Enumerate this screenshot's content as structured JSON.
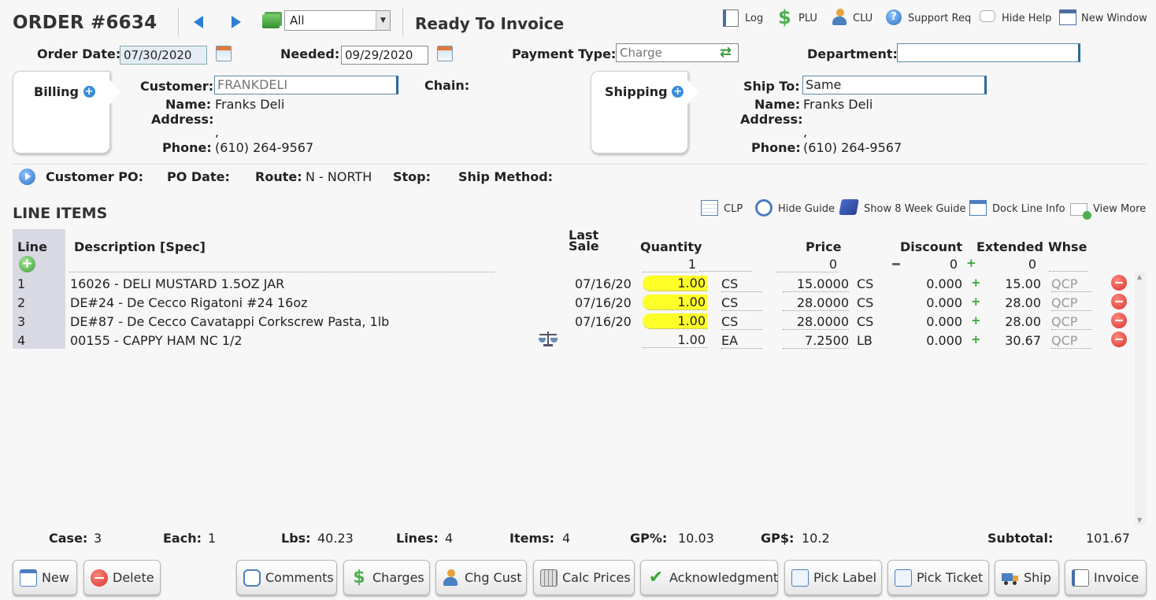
{
  "header": {
    "order_title": "ORDER #6634",
    "filter_value": "All",
    "status": "Ready To Invoice",
    "links": [
      "Log",
      "PLU",
      "CLU",
      "Support Req",
      "Hide Help",
      "New Window"
    ]
  },
  "order_info": {
    "order_date_label": "Order Date:",
    "order_date": "07/30/2020",
    "needed_label": "Needed:",
    "needed": "09/29/2020",
    "payment_type_label": "Payment Type:",
    "payment_type": "Charge",
    "department_label": "Department:",
    "department": ""
  },
  "billing": {
    "tab_label": "Billing",
    "customer_label": "Customer:",
    "customer": "FRANKDELI",
    "name_label": "Name:",
    "name": "Franks Deli",
    "address_label": "Address:",
    "address_line": ",",
    "phone_label": "Phone:",
    "phone": "(610) 264-9567",
    "chain_label": "Chain:"
  },
  "shipping": {
    "tab_label": "Shipping",
    "ship_to_label": "Ship To:",
    "ship_to": "Same",
    "name_label": "Name:",
    "name": "Franks Deli",
    "address_label": "Address:",
    "address_line": ",",
    "phone_label": "Phone:",
    "phone": "(610) 264-9567"
  },
  "po_bar": {
    "customer_po_label": "Customer PO:",
    "po_date_label": "PO Date:",
    "route_label": "Route:",
    "route": "N - NORTH",
    "stop_label": "Stop:",
    "ship_method_label": "Ship Method:"
  },
  "line_items": {
    "title": "LINE ITEMS",
    "links": [
      "CLP",
      "Hide Guide",
      "Show 8 Week Guide",
      "Dock Line Info",
      "View More"
    ],
    "headers": {
      "line": "Line",
      "description": "Description [Spec]",
      "last_sale_1": "Last",
      "last_sale_2": "Sale",
      "quantity": "Quantity",
      "price": "Price",
      "discount": "Discount",
      "extended": "Extended",
      "whse": "Whse"
    },
    "entry_row": {
      "quantity": "1",
      "price": "0",
      "discount": "0",
      "extended": "0"
    },
    "rows": [
      {
        "line": "1",
        "description": "16026 - DELI MUSTARD 1.5OZ JAR",
        "last_sale": "07/16/20",
        "quantity": "1.00",
        "qty_uom": "CS",
        "price": "15.0000",
        "price_uom": "CS",
        "discount": "0.000",
        "extended": "15.00",
        "whse": "QCP"
      },
      {
        "line": "2",
        "description": "DE#24 - De Cecco Rigatoni #24 16oz",
        "last_sale": "07/16/20",
        "quantity": "1.00",
        "qty_uom": "CS",
        "price": "28.0000",
        "price_uom": "CS",
        "discount": "0.000",
        "extended": "28.00",
        "whse": "QCP"
      },
      {
        "line": "3",
        "description": "DE#87 - De Cecco Cavatappi Corkscrew Pasta, 1lb",
        "last_sale": "07/16/20",
        "quantity": "1.00",
        "qty_uom": "CS",
        "price": "28.0000",
        "price_uom": "CS",
        "discount": "0.000",
        "extended": "28.00",
        "whse": "QCP"
      },
      {
        "line": "4",
        "description": "00155 - CAPPY HAM NC 1/2",
        "last_sale": "",
        "quantity": "1.00",
        "qty_uom": "EA",
        "price": "7.2500",
        "price_uom": "LB",
        "discount": "0.000",
        "extended": "30.67",
        "whse": "QCP"
      }
    ]
  },
  "totals": {
    "case_label": "Case:",
    "case": "3",
    "each_label": "Each:",
    "each": "1",
    "lbs_label": "Lbs:",
    "lbs": "40.23",
    "lines_label": "Lines:",
    "lines": "4",
    "items_label": "Items:",
    "items": "4",
    "gp_pct_label": "GP%:",
    "gp_pct": "10.03",
    "gp_dollar_label": "GP$:",
    "gp_dollar": "10.2",
    "subtotal_label": "Subtotal:",
    "subtotal": "101.67"
  },
  "buttons": {
    "new": "New",
    "delete": "Delete",
    "comments": "Comments",
    "charges": "Charges",
    "chg_cust": "Chg Cust",
    "calc_prices": "Calc Prices",
    "acknowledgment": "Acknowledgment",
    "pick_label": "Pick Label",
    "pick_ticket": "Pick Ticket",
    "ship": "Ship",
    "invoice": "Invoice"
  },
  "colors": {
    "quantity_highlight": "#ffff2a",
    "delete_red": "#d9302a",
    "add_green": "#3aa63a",
    "link_blue": "#3b8fd6"
  }
}
